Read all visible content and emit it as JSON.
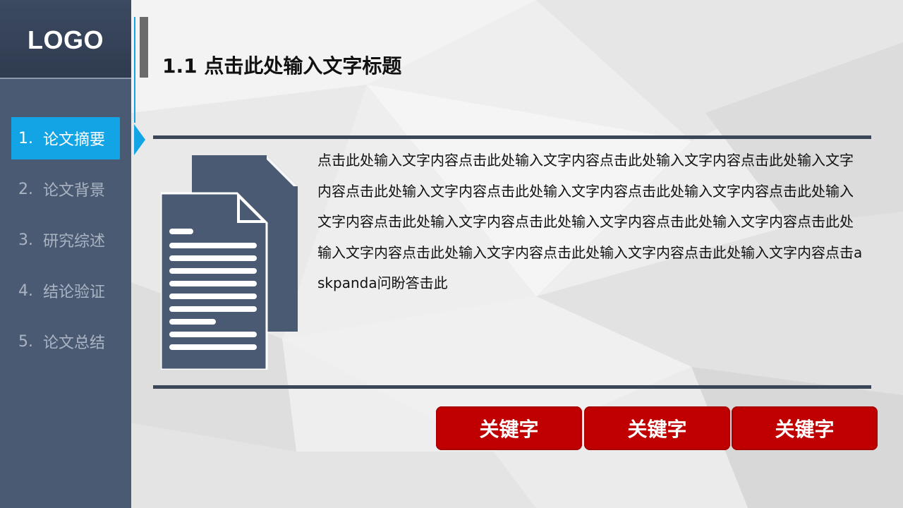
{
  "logo": {
    "text": "LOGO"
  },
  "nav": {
    "items": [
      {
        "num": "1.",
        "label": "论文摘要",
        "active": true
      },
      {
        "num": "2.",
        "label": "论文背景",
        "active": false
      },
      {
        "num": "3.",
        "label": "研究综述",
        "active": false
      },
      {
        "num": "4.",
        "label": "结论验证",
        "active": false
      },
      {
        "num": "5.",
        "label": "论文总结",
        "active": false
      }
    ]
  },
  "page": {
    "title": "1.1 点击此处输入文字标题",
    "body": "点击此处输入文字内容点击此处输入文字内容点击此处输入文字内容点击此处输入文字内容点击此处输入文字内容点击此处输入文字内容点击此处输入文字内容点击此处输入文字内容点击此处输入文字内容点击此处输入文字内容点击此处输入文字内容点击此处输入文字内容点击此处输入文字内容点击此处输入文字内容点击此处输入文字内容点击askpanda问盼答击此"
  },
  "keywords": [
    {
      "label": "关键字"
    },
    {
      "label": "关键字"
    },
    {
      "label": "关键字"
    }
  ],
  "icons": {
    "document": "document-stack-icon",
    "active_pointer": "triangle-right-icon"
  },
  "colors": {
    "sidebar": "#4b5a73",
    "logo_bg": "#2f3b4f",
    "accent_blue": "#13a4e6",
    "keyword_red": "#c00000",
    "rule": "#3b4658",
    "icon": "#4b5a73"
  }
}
